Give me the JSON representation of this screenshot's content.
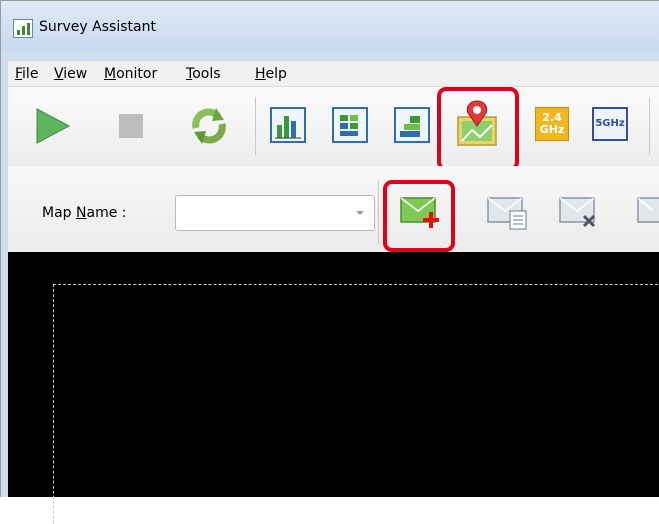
{
  "window": {
    "title": "Survey Assistant",
    "icon": "app-icon"
  },
  "menu": [
    {
      "label": "File",
      "mnemonic": "F",
      "rest": "ile"
    },
    {
      "label": "View",
      "mnemonic": "V",
      "rest": "iew"
    },
    {
      "label": "Monitor",
      "mnemonic": "M",
      "rest": "onitor"
    },
    {
      "label": "Tools",
      "mnemonic": "T",
      "rest": "ools"
    },
    {
      "label": "Help",
      "mnemonic": "H",
      "rest": "elp"
    }
  ],
  "toolbar": {
    "band_24_line1": "2.4",
    "band_24_line2": "GHz",
    "band_5": "5GHz",
    "highlighted_tool": "map-survey-button"
  },
  "map_toolbar": {
    "label_prefix": "Map ",
    "label_mnemonic": "N",
    "label_suffix": "ame :",
    "map_name_value": "",
    "highlighted_tool": "add-map-button"
  },
  "colors": {
    "highlight": "#e0001b",
    "map_background": "#000000",
    "play_green": "#4aa84a"
  }
}
